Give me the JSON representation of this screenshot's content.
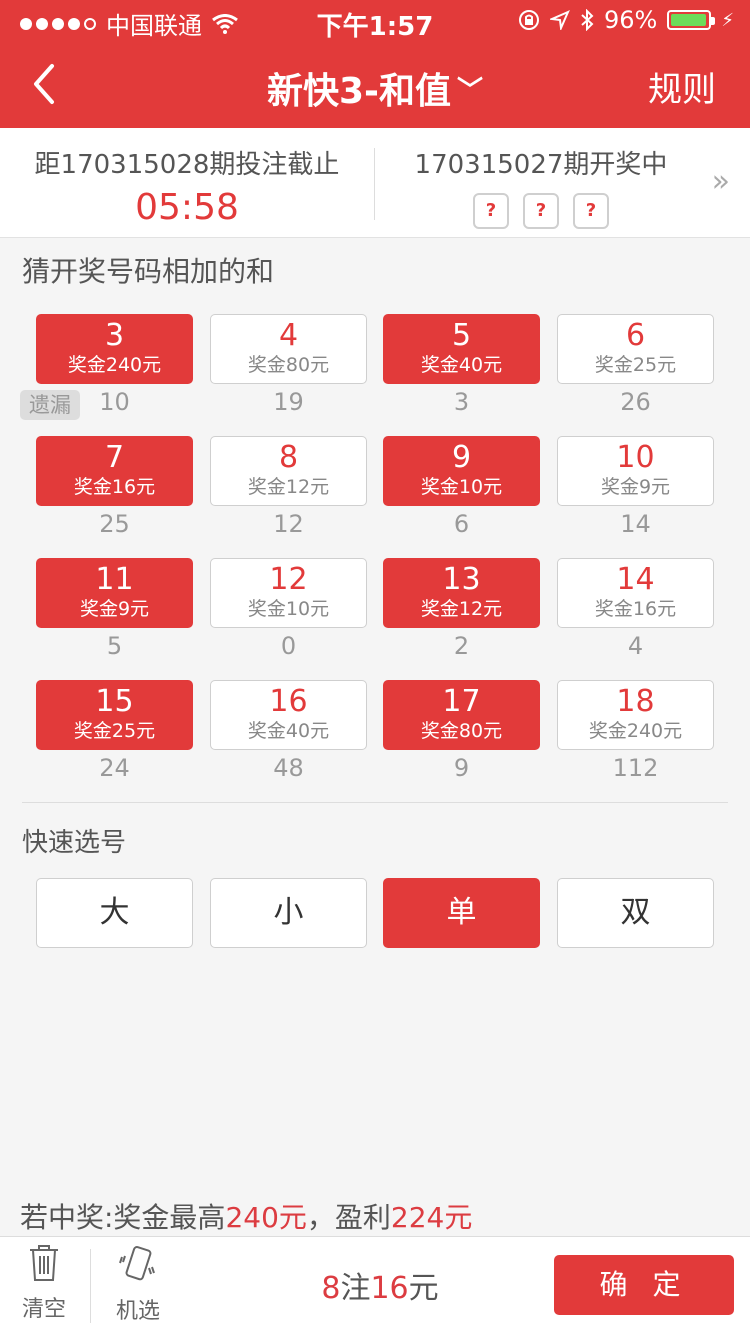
{
  "status_bar": {
    "carrier": "中国联通",
    "time": "下午1:57",
    "battery": "96%",
    "battery_level": 0.96
  },
  "nav": {
    "title": "新快3-和值",
    "rules": "规则"
  },
  "issue": {
    "countdown_label": "距170315028期投注截止",
    "countdown": "05:58",
    "draw_label": "170315027期开奖中",
    "dice": [
      "?",
      "?",
      "?"
    ]
  },
  "guess_title": "猜开奖号码相加的和",
  "miss_tag": "遗漏",
  "sums": [
    {
      "num": "3",
      "prize": "奖金240元",
      "miss": "10",
      "selected": true
    },
    {
      "num": "4",
      "prize": "奖金80元",
      "miss": "19",
      "selected": false
    },
    {
      "num": "5",
      "prize": "奖金40元",
      "miss": "3",
      "selected": true
    },
    {
      "num": "6",
      "prize": "奖金25元",
      "miss": "26",
      "selected": false
    },
    {
      "num": "7",
      "prize": "奖金16元",
      "miss": "25",
      "selected": true
    },
    {
      "num": "8",
      "prize": "奖金12元",
      "miss": "12",
      "selected": false
    },
    {
      "num": "9",
      "prize": "奖金10元",
      "miss": "6",
      "selected": true
    },
    {
      "num": "10",
      "prize": "奖金9元",
      "miss": "14",
      "selected": false
    },
    {
      "num": "11",
      "prize": "奖金9元",
      "miss": "5",
      "selected": true
    },
    {
      "num": "12",
      "prize": "奖金10元",
      "miss": "0",
      "selected": false
    },
    {
      "num": "13",
      "prize": "奖金12元",
      "miss": "2",
      "selected": true
    },
    {
      "num": "14",
      "prize": "奖金16元",
      "miss": "4",
      "selected": false
    },
    {
      "num": "15",
      "prize": "奖金25元",
      "miss": "24",
      "selected": true
    },
    {
      "num": "16",
      "prize": "奖金40元",
      "miss": "48",
      "selected": false
    },
    {
      "num": "17",
      "prize": "奖金80元",
      "miss": "9",
      "selected": true
    },
    {
      "num": "18",
      "prize": "奖金240元",
      "miss": "112",
      "selected": false
    }
  ],
  "quick_title": "快速选号",
  "quick": [
    {
      "label": "大",
      "selected": false
    },
    {
      "label": "小",
      "selected": false
    },
    {
      "label": "单",
      "selected": true
    },
    {
      "label": "双",
      "selected": false
    }
  ],
  "summary": {
    "prefix": "若中奖:奖金最高",
    "max_prize": "240元",
    "mid": "，盈利",
    "profit": "224元"
  },
  "bottom": {
    "clear": "清空",
    "random": "机选",
    "count": "8",
    "count_unit": "注",
    "amount": "16",
    "amount_unit": "元",
    "confirm": "确 定"
  },
  "colors": {
    "brand": "#e23a3a",
    "highlight": "#dc3c41",
    "text": "#555555",
    "white": "#ffffff"
  }
}
